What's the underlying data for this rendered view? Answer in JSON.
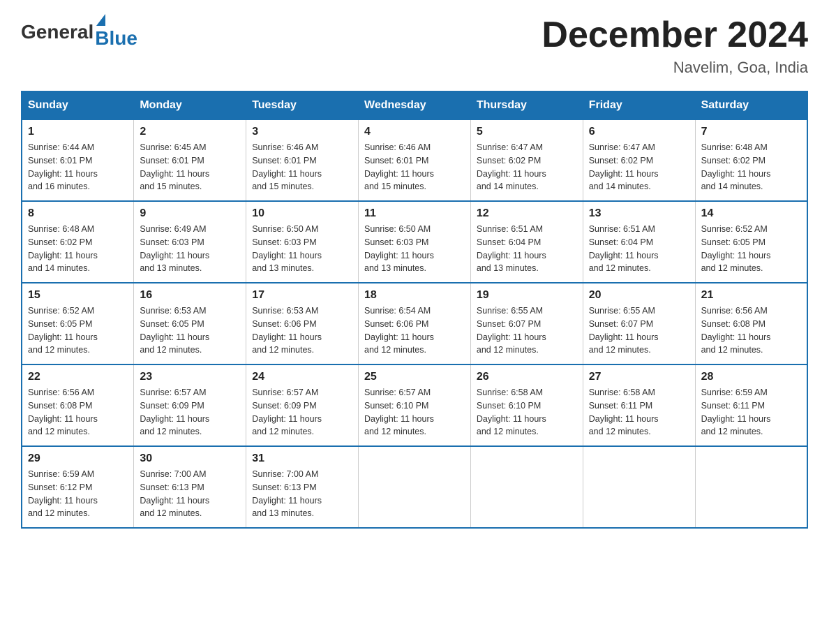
{
  "logo": {
    "general": "General",
    "blue": "Blue"
  },
  "title": "December 2024",
  "location": "Navelim, Goa, India",
  "days_of_week": [
    "Sunday",
    "Monday",
    "Tuesday",
    "Wednesday",
    "Thursday",
    "Friday",
    "Saturday"
  ],
  "weeks": [
    [
      {
        "day": "1",
        "sunrise": "6:44 AM",
        "sunset": "6:01 PM",
        "daylight": "11 hours and 16 minutes."
      },
      {
        "day": "2",
        "sunrise": "6:45 AM",
        "sunset": "6:01 PM",
        "daylight": "11 hours and 15 minutes."
      },
      {
        "day": "3",
        "sunrise": "6:46 AM",
        "sunset": "6:01 PM",
        "daylight": "11 hours and 15 minutes."
      },
      {
        "day": "4",
        "sunrise": "6:46 AM",
        "sunset": "6:01 PM",
        "daylight": "11 hours and 15 minutes."
      },
      {
        "day": "5",
        "sunrise": "6:47 AM",
        "sunset": "6:02 PM",
        "daylight": "11 hours and 14 minutes."
      },
      {
        "day": "6",
        "sunrise": "6:47 AM",
        "sunset": "6:02 PM",
        "daylight": "11 hours and 14 minutes."
      },
      {
        "day": "7",
        "sunrise": "6:48 AM",
        "sunset": "6:02 PM",
        "daylight": "11 hours and 14 minutes."
      }
    ],
    [
      {
        "day": "8",
        "sunrise": "6:48 AM",
        "sunset": "6:02 PM",
        "daylight": "11 hours and 14 minutes."
      },
      {
        "day": "9",
        "sunrise": "6:49 AM",
        "sunset": "6:03 PM",
        "daylight": "11 hours and 13 minutes."
      },
      {
        "day": "10",
        "sunrise": "6:50 AM",
        "sunset": "6:03 PM",
        "daylight": "11 hours and 13 minutes."
      },
      {
        "day": "11",
        "sunrise": "6:50 AM",
        "sunset": "6:03 PM",
        "daylight": "11 hours and 13 minutes."
      },
      {
        "day": "12",
        "sunrise": "6:51 AM",
        "sunset": "6:04 PM",
        "daylight": "11 hours and 13 minutes."
      },
      {
        "day": "13",
        "sunrise": "6:51 AM",
        "sunset": "6:04 PM",
        "daylight": "11 hours and 12 minutes."
      },
      {
        "day": "14",
        "sunrise": "6:52 AM",
        "sunset": "6:05 PM",
        "daylight": "11 hours and 12 minutes."
      }
    ],
    [
      {
        "day": "15",
        "sunrise": "6:52 AM",
        "sunset": "6:05 PM",
        "daylight": "11 hours and 12 minutes."
      },
      {
        "day": "16",
        "sunrise": "6:53 AM",
        "sunset": "6:05 PM",
        "daylight": "11 hours and 12 minutes."
      },
      {
        "day": "17",
        "sunrise": "6:53 AM",
        "sunset": "6:06 PM",
        "daylight": "11 hours and 12 minutes."
      },
      {
        "day": "18",
        "sunrise": "6:54 AM",
        "sunset": "6:06 PM",
        "daylight": "11 hours and 12 minutes."
      },
      {
        "day": "19",
        "sunrise": "6:55 AM",
        "sunset": "6:07 PM",
        "daylight": "11 hours and 12 minutes."
      },
      {
        "day": "20",
        "sunrise": "6:55 AM",
        "sunset": "6:07 PM",
        "daylight": "11 hours and 12 minutes."
      },
      {
        "day": "21",
        "sunrise": "6:56 AM",
        "sunset": "6:08 PM",
        "daylight": "11 hours and 12 minutes."
      }
    ],
    [
      {
        "day": "22",
        "sunrise": "6:56 AM",
        "sunset": "6:08 PM",
        "daylight": "11 hours and 12 minutes."
      },
      {
        "day": "23",
        "sunrise": "6:57 AM",
        "sunset": "6:09 PM",
        "daylight": "11 hours and 12 minutes."
      },
      {
        "day": "24",
        "sunrise": "6:57 AM",
        "sunset": "6:09 PM",
        "daylight": "11 hours and 12 minutes."
      },
      {
        "day": "25",
        "sunrise": "6:57 AM",
        "sunset": "6:10 PM",
        "daylight": "11 hours and 12 minutes."
      },
      {
        "day": "26",
        "sunrise": "6:58 AM",
        "sunset": "6:10 PM",
        "daylight": "11 hours and 12 minutes."
      },
      {
        "day": "27",
        "sunrise": "6:58 AM",
        "sunset": "6:11 PM",
        "daylight": "11 hours and 12 minutes."
      },
      {
        "day": "28",
        "sunrise": "6:59 AM",
        "sunset": "6:11 PM",
        "daylight": "11 hours and 12 minutes."
      }
    ],
    [
      {
        "day": "29",
        "sunrise": "6:59 AM",
        "sunset": "6:12 PM",
        "daylight": "11 hours and 12 minutes."
      },
      {
        "day": "30",
        "sunrise": "7:00 AM",
        "sunset": "6:13 PM",
        "daylight": "11 hours and 12 minutes."
      },
      {
        "day": "31",
        "sunrise": "7:00 AM",
        "sunset": "6:13 PM",
        "daylight": "11 hours and 13 minutes."
      },
      null,
      null,
      null,
      null
    ]
  ],
  "labels": {
    "sunrise": "Sunrise:",
    "sunset": "Sunset:",
    "daylight": "Daylight:"
  }
}
